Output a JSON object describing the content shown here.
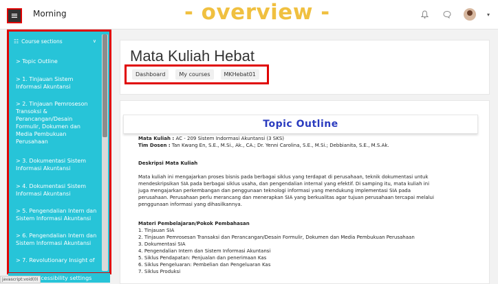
{
  "topbar": {
    "site_name": "Morning",
    "overlay_title": "- overview -"
  },
  "sidebar": {
    "header": "Course sections",
    "items": [
      "> Topic Outline",
      "> 1. Tinjauan Sistem Informasi Akuntansi",
      "> 2. Tinjauan Pemroseson Transoksi & Perancangan/Desain Formulir, Dokumen dan Media Pembukuan Perusahaan",
      "> 3. Dokumentasi Sistem Informasi Akuntansi",
      "> 4. Dokumentasi Sistem Informasi Akuntansi",
      "> 5. Pengendalian Intern dan Sistem Informasi Akuntansi",
      "> 6. Pengendalian Intern dan Sistem Informasi Akuntansi",
      "> 7. Revolutionary Insight of"
    ],
    "accessibility": "Accessibility settings"
  },
  "status_text": "javascript:void(0)",
  "course": {
    "title": "Mata Kuliah Hebat",
    "breadcrumbs": [
      "Dashboard",
      "My courses",
      "MKHebat01"
    ]
  },
  "content": {
    "heading": "Topic Outline",
    "mk_label": "Mata Kuliah :",
    "mk_value": " AC - 209 Sistem Indormasi Akuntansi (3 SKS)",
    "dosen_label": "Tim Dosen :",
    "dosen_value": " Tan Kwang En, S.E., M.Si., Ak., CA.; Dr. Yenni Carolina, S.E., M.Si.; Debbianita, S.E., M.S.Ak.",
    "deskripsi_label": "Deskripsi Mata Kuliah",
    "deskripsi_lines": [
      "Mata kuliah ini mengajarkan proses bisnis pada berbagai siklus yang terdapat di perusahaan, teknik dokumentasi untuk",
      "mendeskripsikan SIA pada berbagai siklus usaha, dan  pengendalian internal yang efektif. Di samping itu, mata kuliah ini",
      "juga mengajarkan perkembangan dan penggunaan teknologi informasi yang mendukung implementasi SIA pada",
      "perusahaan. Perusahaan perlu merancang dan menerapkan SIA yang berkualitas agar tujuan perusahaan tercapai melalui",
      "penggunaan informasi yang dihasilkannya."
    ],
    "materi_label": "Materi Pembelajaran/Pokok Pembahasan",
    "materi_items": [
      "1. Tinjauan SIA",
      "2. Tinjauan Pemrosesan Transaksi dan Perancangan/Desain Formulir, Dokumen dan Media Pembukuan Perusahaan",
      "3. Dokumentasi SIA",
      "4. Pengendalian Intern dan Sistem Informasi Akuntansi",
      "5. Siklus Pendapatan: Penjualan dan penerimaan Kas",
      "6. Siklus Pengeluaran: Pembelian dan Pengeluaran Kas",
      "7. Siklus Produksi"
    ]
  }
}
